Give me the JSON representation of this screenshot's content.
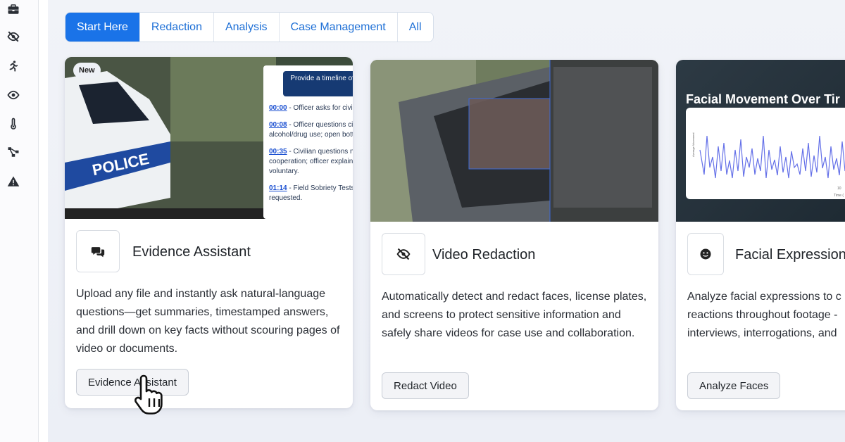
{
  "tabs": [
    {
      "label": "Start Here",
      "active": true
    },
    {
      "label": "Redaction",
      "active": false
    },
    {
      "label": "Analysis",
      "active": false
    },
    {
      "label": "Case Management",
      "active": false
    },
    {
      "label": "All",
      "active": false
    }
  ],
  "sidebar": {
    "icons": [
      "briefcase-icon",
      "eye-slash-icon",
      "running-person-icon",
      "eye-icon",
      "thermometer-icon",
      "network-icon",
      "warning-icon"
    ]
  },
  "cards": {
    "evidence": {
      "badge": "New",
      "title": "Evidence Assistant",
      "description": "Upload any file and instantly ask natural-language questions—get summaries, timestamped answers, and drill down on key facts without scouring pages of video or documents.",
      "button": "Evidence Assistant",
      "icon": "chat-bubbles-icon",
      "media": {
        "car_text": "POLICE",
        "prompt": "Provide a timeline of events for this video",
        "timeline": [
          {
            "time": "00:00",
            "text": " - Officer asks for civilian's name."
          },
          {
            "time": "00:08",
            "text": " - Officer questions civilian about alcohol/drug use; open bottle mentioned."
          },
          {
            "time": "00:35",
            "text": " - Civilian questions necessity of cooperation; officer explains tests are voluntary."
          },
          {
            "time": "01:14",
            "text": " - Field Sobriety Tests (FST) requested."
          }
        ]
      }
    },
    "redaction": {
      "title": "Video Redaction",
      "description": "Automatically detect and redact faces, license plates, and screens to protect sensitive information and safely share videos for case use and collaboration.",
      "button": "Redact Video",
      "icon": "eye-slash-icon"
    },
    "facial": {
      "title": "Facial Expression",
      "description": "Analyze facial expressions to c reactions throughout footage - interviews, interrogations, and",
      "button": "Analyze Faces",
      "icon": "smile-icon",
      "media": {
        "chart_title": "Facial Movement Over Tir",
        "chart_ylabel": "Average Movement",
        "chart_xlabel": "Time (",
        "chart_tick": "10"
      }
    }
  },
  "cursor": "hand-pointer-icon"
}
